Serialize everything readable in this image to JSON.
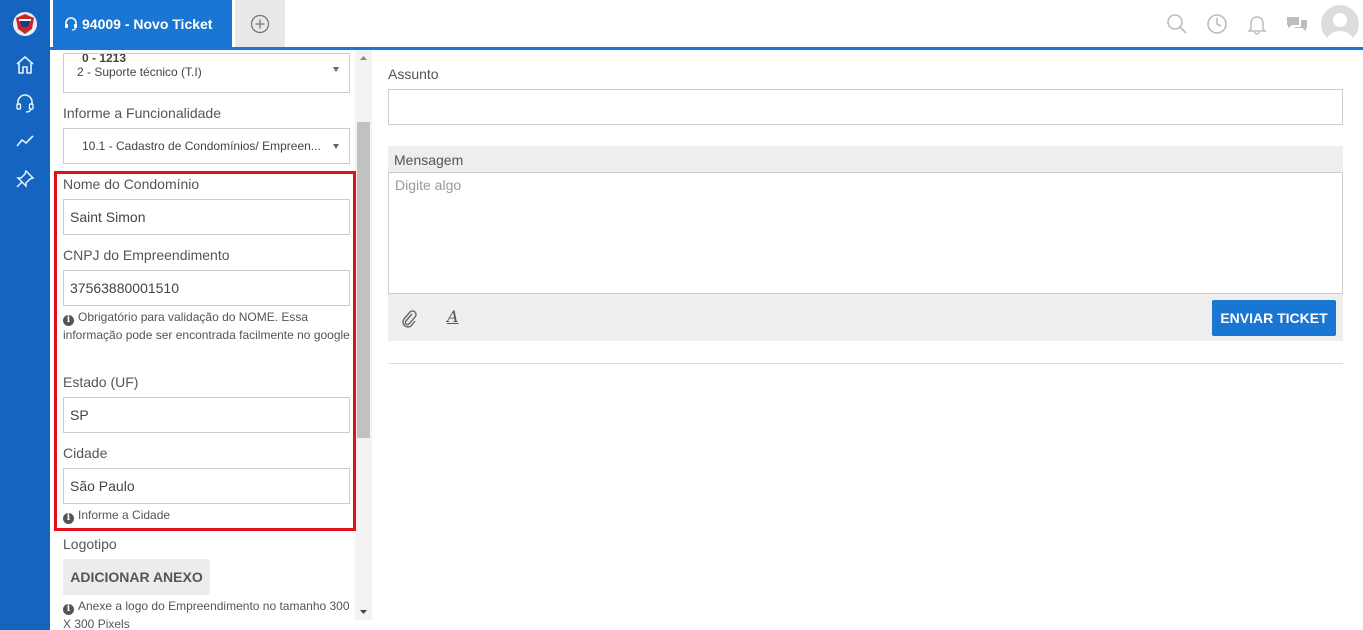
{
  "app": {
    "tab_title": "94009 - Novo Ticket"
  },
  "rail": {
    "items": [
      "home-icon",
      "headset-icon",
      "trend-icon",
      "pin-icon"
    ]
  },
  "topbar": {
    "icons": [
      "search-icon",
      "clock-icon",
      "bell-icon",
      "chat-icon",
      "avatar"
    ]
  },
  "form": {
    "category_partial": "0 - 1213",
    "category_value": "2 - Suporte técnico (T.I)",
    "funcionalidade_label": "Informe a Funcionalidade",
    "funcionalidade_value": "10.1 - Cadastro de Condomínios/ Empreen...",
    "nome_label": "Nome do Condomínio",
    "nome_value": "Saint Simon",
    "cnpj_label": "CNPJ do Empreendimento",
    "cnpj_value": "37563880001510",
    "cnpj_help": "Obrigatório para validação do NOME. Essa informação pode ser encontrada facilmente no google",
    "estado_label": "Estado (UF)",
    "estado_value": "SP",
    "cidade_label": "Cidade",
    "cidade_value": "São Paulo",
    "cidade_help": "Informe a Cidade",
    "logotipo_label": "Logotipo",
    "anexo_button": "ADICIONAR ANEXO",
    "logotipo_help": "Anexe a logo do Empreendimento no tamanho 300 X 300 Pixels"
  },
  "main": {
    "assunto_label": "Assunto",
    "assunto_value": "",
    "mensagem_label": "Mensagem",
    "mensagem_placeholder": "Digite algo",
    "font_tool": "A",
    "send_button": "ENVIAR TICKET"
  },
  "colors": {
    "brand": "#1976d2",
    "rail": "#1565c0",
    "highlight": "#e0101b"
  }
}
